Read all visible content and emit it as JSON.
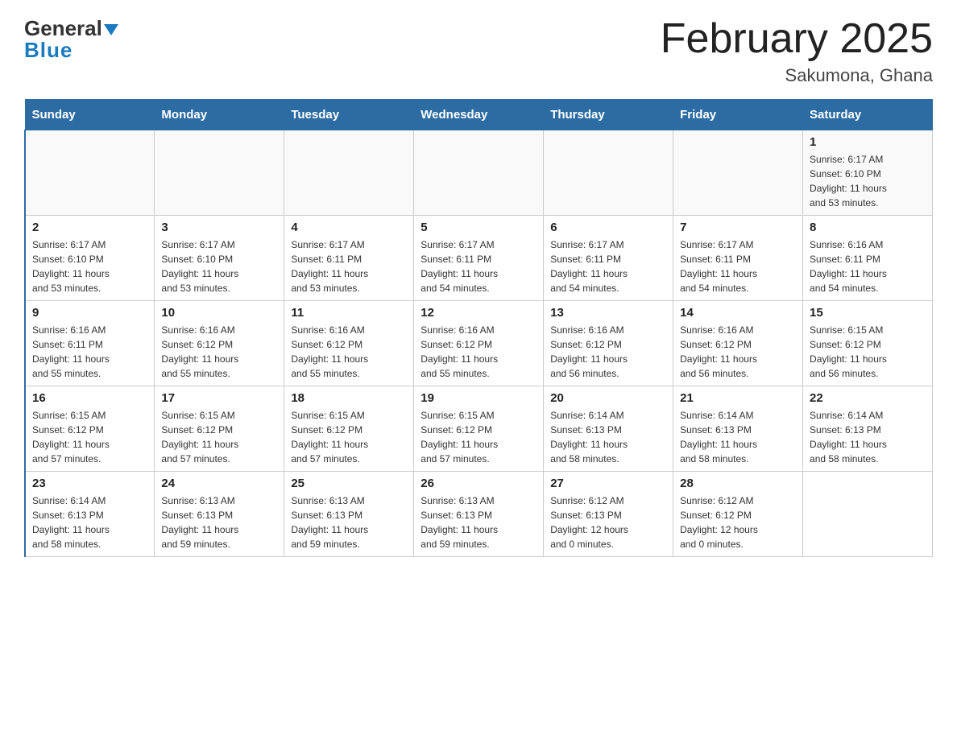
{
  "logo": {
    "general": "General",
    "triangle": "▲",
    "blue": "Blue"
  },
  "header": {
    "title": "February 2025",
    "subtitle": "Sakumona, Ghana"
  },
  "weekdays": [
    "Sunday",
    "Monday",
    "Tuesday",
    "Wednesday",
    "Thursday",
    "Friday",
    "Saturday"
  ],
  "weeks": [
    [
      {
        "day": "",
        "info": ""
      },
      {
        "day": "",
        "info": ""
      },
      {
        "day": "",
        "info": ""
      },
      {
        "day": "",
        "info": ""
      },
      {
        "day": "",
        "info": ""
      },
      {
        "day": "",
        "info": ""
      },
      {
        "day": "1",
        "info": "Sunrise: 6:17 AM\nSunset: 6:10 PM\nDaylight: 11 hours\nand 53 minutes."
      }
    ],
    [
      {
        "day": "2",
        "info": "Sunrise: 6:17 AM\nSunset: 6:10 PM\nDaylight: 11 hours\nand 53 minutes."
      },
      {
        "day": "3",
        "info": "Sunrise: 6:17 AM\nSunset: 6:10 PM\nDaylight: 11 hours\nand 53 minutes."
      },
      {
        "day": "4",
        "info": "Sunrise: 6:17 AM\nSunset: 6:11 PM\nDaylight: 11 hours\nand 53 minutes."
      },
      {
        "day": "5",
        "info": "Sunrise: 6:17 AM\nSunset: 6:11 PM\nDaylight: 11 hours\nand 54 minutes."
      },
      {
        "day": "6",
        "info": "Sunrise: 6:17 AM\nSunset: 6:11 PM\nDaylight: 11 hours\nand 54 minutes."
      },
      {
        "day": "7",
        "info": "Sunrise: 6:17 AM\nSunset: 6:11 PM\nDaylight: 11 hours\nand 54 minutes."
      },
      {
        "day": "8",
        "info": "Sunrise: 6:16 AM\nSunset: 6:11 PM\nDaylight: 11 hours\nand 54 minutes."
      }
    ],
    [
      {
        "day": "9",
        "info": "Sunrise: 6:16 AM\nSunset: 6:11 PM\nDaylight: 11 hours\nand 55 minutes."
      },
      {
        "day": "10",
        "info": "Sunrise: 6:16 AM\nSunset: 6:12 PM\nDaylight: 11 hours\nand 55 minutes."
      },
      {
        "day": "11",
        "info": "Sunrise: 6:16 AM\nSunset: 6:12 PM\nDaylight: 11 hours\nand 55 minutes."
      },
      {
        "day": "12",
        "info": "Sunrise: 6:16 AM\nSunset: 6:12 PM\nDaylight: 11 hours\nand 55 minutes."
      },
      {
        "day": "13",
        "info": "Sunrise: 6:16 AM\nSunset: 6:12 PM\nDaylight: 11 hours\nand 56 minutes."
      },
      {
        "day": "14",
        "info": "Sunrise: 6:16 AM\nSunset: 6:12 PM\nDaylight: 11 hours\nand 56 minutes."
      },
      {
        "day": "15",
        "info": "Sunrise: 6:15 AM\nSunset: 6:12 PM\nDaylight: 11 hours\nand 56 minutes."
      }
    ],
    [
      {
        "day": "16",
        "info": "Sunrise: 6:15 AM\nSunset: 6:12 PM\nDaylight: 11 hours\nand 57 minutes."
      },
      {
        "day": "17",
        "info": "Sunrise: 6:15 AM\nSunset: 6:12 PM\nDaylight: 11 hours\nand 57 minutes."
      },
      {
        "day": "18",
        "info": "Sunrise: 6:15 AM\nSunset: 6:12 PM\nDaylight: 11 hours\nand 57 minutes."
      },
      {
        "day": "19",
        "info": "Sunrise: 6:15 AM\nSunset: 6:12 PM\nDaylight: 11 hours\nand 57 minutes."
      },
      {
        "day": "20",
        "info": "Sunrise: 6:14 AM\nSunset: 6:13 PM\nDaylight: 11 hours\nand 58 minutes."
      },
      {
        "day": "21",
        "info": "Sunrise: 6:14 AM\nSunset: 6:13 PM\nDaylight: 11 hours\nand 58 minutes."
      },
      {
        "day": "22",
        "info": "Sunrise: 6:14 AM\nSunset: 6:13 PM\nDaylight: 11 hours\nand 58 minutes."
      }
    ],
    [
      {
        "day": "23",
        "info": "Sunrise: 6:14 AM\nSunset: 6:13 PM\nDaylight: 11 hours\nand 58 minutes."
      },
      {
        "day": "24",
        "info": "Sunrise: 6:13 AM\nSunset: 6:13 PM\nDaylight: 11 hours\nand 59 minutes."
      },
      {
        "day": "25",
        "info": "Sunrise: 6:13 AM\nSunset: 6:13 PM\nDaylight: 11 hours\nand 59 minutes."
      },
      {
        "day": "26",
        "info": "Sunrise: 6:13 AM\nSunset: 6:13 PM\nDaylight: 11 hours\nand 59 minutes."
      },
      {
        "day": "27",
        "info": "Sunrise: 6:12 AM\nSunset: 6:13 PM\nDaylight: 12 hours\nand 0 minutes."
      },
      {
        "day": "28",
        "info": "Sunrise: 6:12 AM\nSunset: 6:12 PM\nDaylight: 12 hours\nand 0 minutes."
      },
      {
        "day": "",
        "info": ""
      }
    ]
  ]
}
